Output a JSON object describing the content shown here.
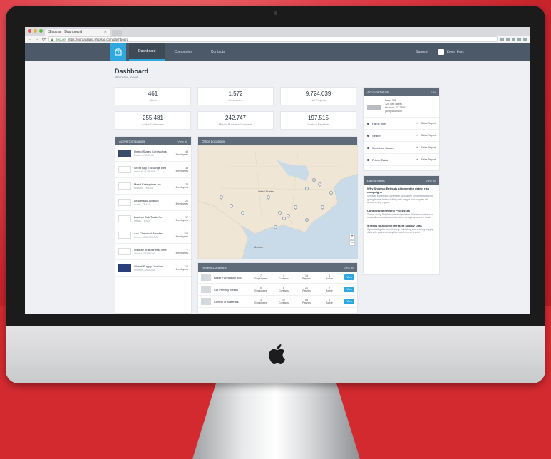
{
  "browser": {
    "tab_title": "Shiptrac | Dashboard",
    "secure_label": "Secure",
    "url": "https://ourdataapp.shiptrac.com/dashboard"
  },
  "app": {
    "nav": [
      "Dashboard",
      "Companies",
      "Contacts"
    ],
    "header_right": [
      "Support",
      "Kevin Park"
    ]
  },
  "page": {
    "title": "Dashboard",
    "subtitle": "Welcome, Kevin"
  },
  "stats": [
    {
      "value": "461",
      "label": "Cities"
    },
    {
      "value": "1,572",
      "label": "Companies"
    },
    {
      "value": "9,724,039",
      "label": "Net Payees"
    },
    {
      "value": "255,481",
      "label": "Active Customers"
    },
    {
      "value": "242,747",
      "label": "Middle Business Contracts"
    },
    {
      "value": "197,515",
      "label": "Contact Payables"
    }
  ],
  "companies_panel": {
    "title": "Active Companies",
    "action": "View all",
    "rows": [
      {
        "name": "United States Contractors",
        "meta": "Fairfax, VIRGINIA",
        "count": "48",
        "unit": "Employees"
      },
      {
        "name": "Great Bay Exchange Bird",
        "meta": "Orlando, FLORIDA",
        "count": "38",
        "unit": "Employees"
      },
      {
        "name": "Mead Enterprises Inc",
        "meta": "Houston, TEXAS",
        "count": "24",
        "unit": "Employees"
      },
      {
        "name": "Leadership Alliance",
        "meta": "Austin, TEXAS",
        "count": "20",
        "unit": "Employees"
      },
      {
        "name": "Lantern Oak Trade Net",
        "meta": "Dallas, TEXAS",
        "count": "17",
        "unit": "Employees"
      },
      {
        "name": "Ace Chemical Blender",
        "meta": "Denver, COLORADO",
        "count": "108",
        "unit": "Employees"
      },
      {
        "name": "Institute of Business Time",
        "meta": "Atlanta, GEORGIA",
        "count": "7",
        "unit": "Employees"
      },
      {
        "name": "Global Supply Division",
        "meta": "Phoenix, ARIZONA",
        "count": "12",
        "unit": "Employees"
      }
    ]
  },
  "map_panel": {
    "title": "Office Locations",
    "country_label": "United States",
    "gulf_label": "Mexico"
  },
  "locations_panel": {
    "title": "Recent Locations",
    "action": "View all",
    "view_label": "View",
    "rows": [
      {
        "name": "Baker Fabrication Mill",
        "stats": [
          {
            "v": "7",
            "u": "Employees"
          },
          {
            "v": "4",
            "u": "Contacts"
          },
          {
            "v": "13",
            "u": "Payees"
          },
          {
            "v": "4",
            "u": "Active"
          }
        ]
      },
      {
        "name": "Cut Primary Metals",
        "stats": [
          {
            "v": "5",
            "u": "Employees"
          },
          {
            "v": "8",
            "u": "Contacts"
          },
          {
            "v": "21",
            "u": "Payees"
          },
          {
            "v": "2",
            "u": "Active"
          }
        ]
      },
      {
        "name": "Control of Materials",
        "stats": [
          {
            "v": "3",
            "u": "Employees"
          },
          {
            "v": "12",
            "u": "Contacts"
          },
          {
            "v": "88",
            "u": "Payees"
          },
          {
            "v": "6",
            "u": "Active"
          }
        ]
      }
    ]
  },
  "contact_panel": {
    "title": "Account Details",
    "action": "Edit",
    "contact_lines": [
      "Baker Mill",
      "123 Oak Street",
      "Houston, TX 77001",
      "(555) 555-0100"
    ],
    "sources": [
      {
        "name": "Harris Intel",
        "value": "Sales Report"
      },
      {
        "name": "Search",
        "value": "Sales Report"
      },
      {
        "name": "Gold Lion Source",
        "value": "Sales Report"
      },
      {
        "name": "Primer Ratio",
        "value": "Sales Report"
      }
    ]
  },
  "news_panel": {
    "title": "Latest News",
    "action": "View all",
    "items": [
      {
        "title": "Why Shiptrac Extends shipment to detect risk campaigns",
        "body": "Shiptrac extends its coverage across the shipment platform, giving teams faster visibility into freight and supplier risk across every region."
      },
      {
        "title": "Connecting the Best Processes",
        "body": "Teams using Shiptrac connect process data and partners to streamline operations and reduce delays across the chain."
      },
      {
        "title": "5 Steps to Achieve the Best Supply Data",
        "body": "A practical guide to collecting, validating and sharing supply data with partners, suppliers and internal teams."
      }
    ]
  },
  "colors": {
    "accent": "#2fa8e0",
    "header": "#4c5968",
    "panel_head": "#5f6b79",
    "backdrop": "#d9272e"
  },
  "icons": [
    "apple-logo-icon",
    "box-logo-icon",
    "map-pin-icon",
    "check-icon",
    "close-icon",
    "lock-icon"
  ]
}
